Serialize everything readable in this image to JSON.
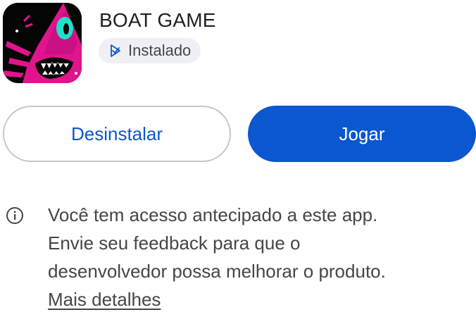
{
  "app": {
    "title": "BOAT GAME",
    "status_chip": "Instalado",
    "icon": "boat-game-app-icon",
    "status_icon": "play-store-installed-icon"
  },
  "actions": {
    "uninstall_label": "Desinstalar",
    "play_label": "Jogar"
  },
  "early_access": {
    "icon": "info-icon",
    "lines": [
      "Você tem acesso antecipado a este app.",
      "Envie seu feedback para que o",
      "desenvolvedor possa melhorar o produto."
    ],
    "link_label": "Mais detalhes"
  },
  "colors": {
    "primary": "#0b57d0",
    "chip_background": "#eef0f4",
    "icon_magenta": "#e0148c",
    "icon_eye": "#1fe0c8"
  }
}
